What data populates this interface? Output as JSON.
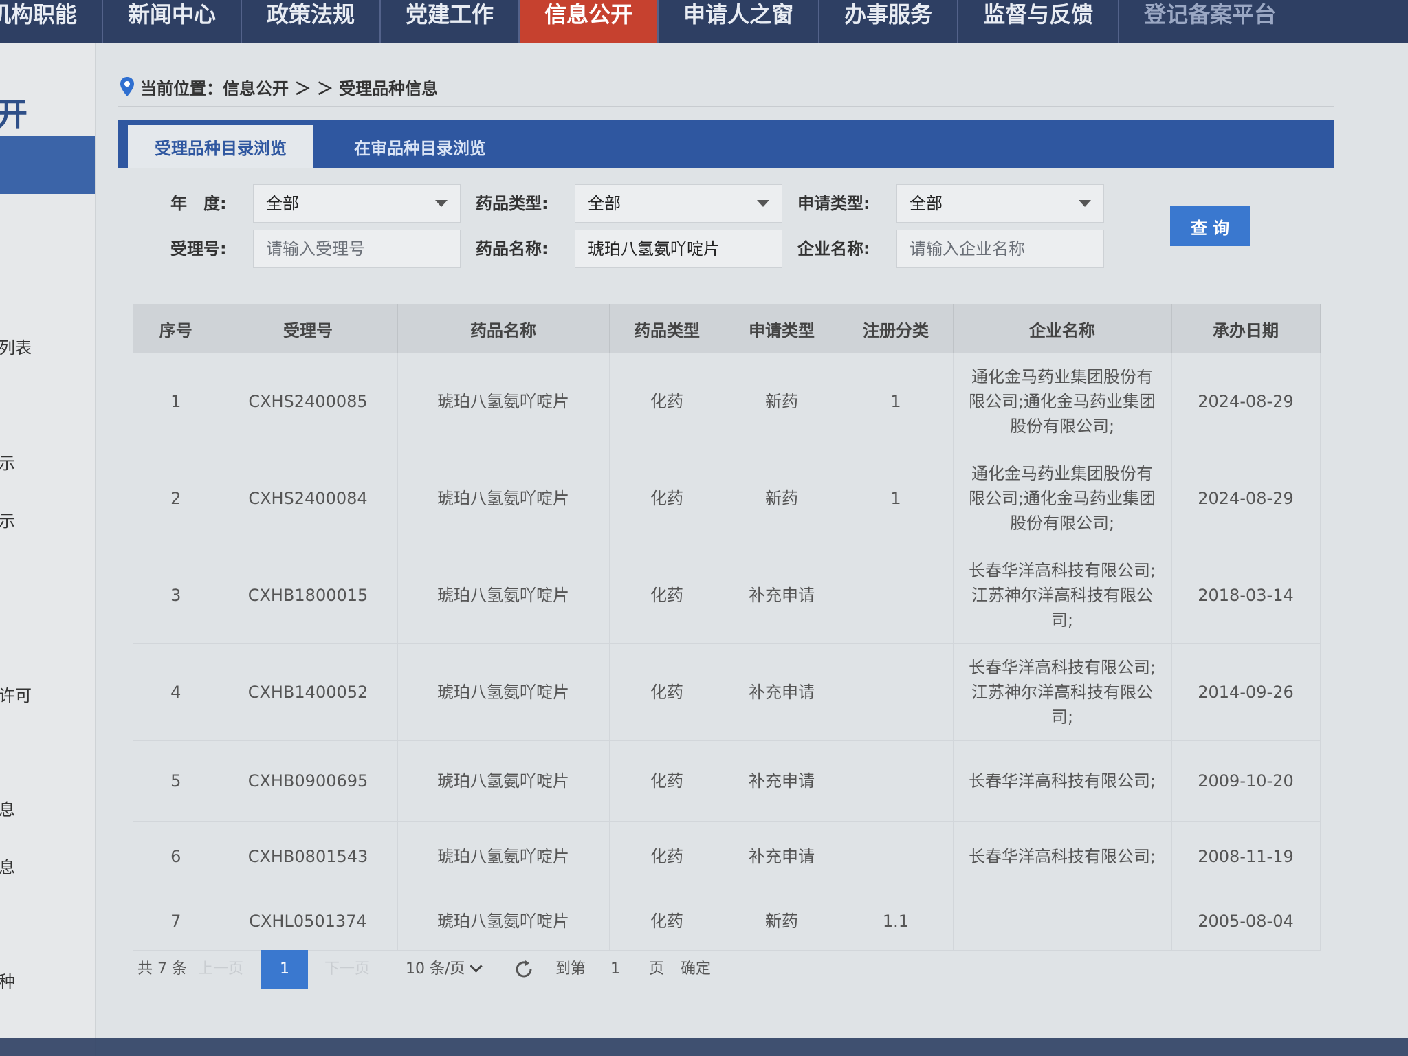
{
  "nav": {
    "items": [
      "机构职能",
      "新闻中心",
      "政策法规",
      "党建工作",
      "信息公开",
      "申请人之窗",
      "办事服务",
      "监督与反馈",
      "登记备案平台"
    ],
    "active_index": 4
  },
  "sidebar": {
    "title": "开",
    "items": [
      "列表",
      "示",
      "示",
      "许可",
      "息",
      "息",
      "种"
    ]
  },
  "breadcrumb": {
    "text": "当前位置：信息公开 ＞ ＞ 受理品种信息"
  },
  "tabs": [
    {
      "label": "受理品种目录浏览",
      "active": true
    },
    {
      "label": "在审品种目录浏览",
      "active": false
    }
  ],
  "filters": {
    "year_label": "年　度:",
    "year_value": "全部",
    "drug_type_label": "药品类型:",
    "drug_type_value": "全部",
    "apply_type_label": "申请类型:",
    "apply_type_value": "全部",
    "accept_no_label": "受理号:",
    "accept_no_placeholder": "请输入受理号",
    "drug_name_label": "药品名称:",
    "drug_name_value": "琥珀八氢氨吖啶片",
    "company_label": "企业名称:",
    "company_placeholder": "请输入企业名称",
    "query_button": "查 询"
  },
  "table": {
    "headers": [
      "序号",
      "受理号",
      "药品名称",
      "药品类型",
      "申请类型",
      "注册分类",
      "企业名称",
      "承办日期"
    ],
    "rows": [
      [
        "1",
        "CXHS2400085",
        "琥珀八氢氨吖啶片",
        "化药",
        "新药",
        "1",
        "通化金马药业集团股份有限公司;通化金马药业集团股份有限公司;",
        "2024-08-29"
      ],
      [
        "2",
        "CXHS2400084",
        "琥珀八氢氨吖啶片",
        "化药",
        "新药",
        "1",
        "通化金马药业集团股份有限公司;通化金马药业集团股份有限公司;",
        "2024-08-29"
      ],
      [
        "3",
        "CXHB1800015",
        "琥珀八氢氨吖啶片",
        "化药",
        "补充申请",
        "",
        "长春华洋高科技有限公司;江苏神尔洋高科技有限公司;",
        "2018-03-14"
      ],
      [
        "4",
        "CXHB1400052",
        "琥珀八氢氨吖啶片",
        "化药",
        "补充申请",
        "",
        "长春华洋高科技有限公司;江苏神尔洋高科技有限公司;",
        "2014-09-26"
      ],
      [
        "5",
        "CXHB0900695",
        "琥珀八氢氨吖啶片",
        "化药",
        "补充申请",
        "",
        "长春华洋高科技有限公司;",
        "2009-10-20"
      ],
      [
        "6",
        "CXHB0801543",
        "琥珀八氢氨吖啶片",
        "化药",
        "补充申请",
        "",
        "长春华洋高科技有限公司;",
        "2008-11-19"
      ],
      [
        "7",
        "CXHL0501374",
        "琥珀八氢氨吖啶片",
        "化药",
        "新药",
        "1.1",
        "",
        "2005-08-04"
      ]
    ]
  },
  "pager": {
    "total": "共 7 条",
    "prev": "上一页",
    "current_page": "1",
    "next": "下一页",
    "page_size": "10 条/页",
    "goto_label": "到第",
    "goto_value": "1",
    "page_unit": "页",
    "confirm": "确定"
  }
}
